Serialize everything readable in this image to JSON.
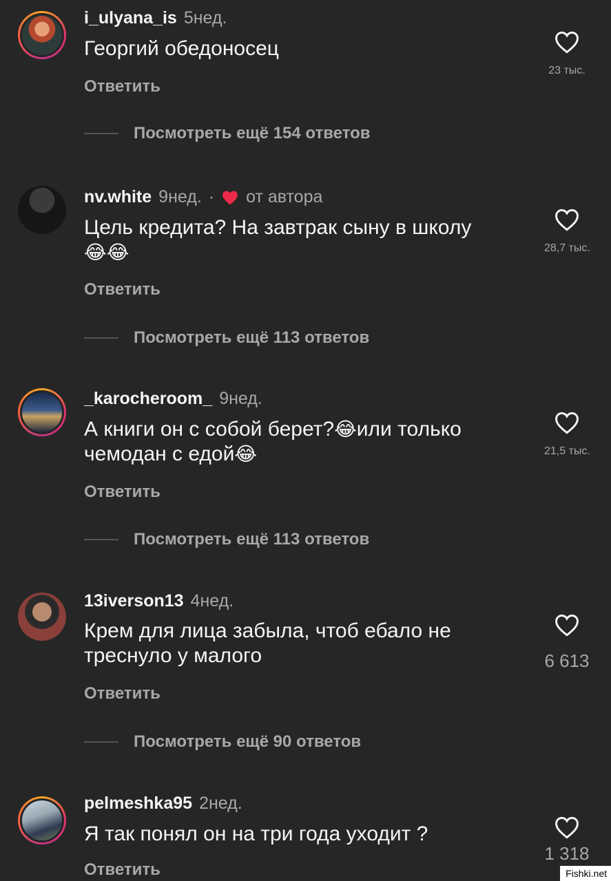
{
  "comments": [
    {
      "username": "i_ulyana_is",
      "time": "5нед.",
      "text": "Георгий обедоносец",
      "reply_label": "Ответить",
      "likes": "23 тыс.",
      "view_more": "Посмотреть ещё 154 ответов"
    },
    {
      "username": "nv.white",
      "time": "9нед.",
      "separator": "·",
      "author_badge": "от автора",
      "text": "Цель кредита? На завтрак сыну в школу",
      "text_emoji": "😂😂",
      "reply_label": "Ответить",
      "likes": "28,7 тыс.",
      "view_more": "Посмотреть ещё 113 ответов"
    },
    {
      "username": "_karocheroom_",
      "time": "9нед.",
      "text_part1": "А книги он с собой берет?",
      "emoji1": "😂",
      "text_part2": "или только чемодан с едой",
      "emoji2": "😂",
      "reply_label": "Ответить",
      "likes": "21,5 тыс.",
      "view_more": "Посмотреть ещё 113 ответов"
    },
    {
      "username": "13iverson13",
      "time": "4нед.",
      "text": "Крем для лица забыла, чтоб ебало не треснуло у малого",
      "reply_label": "Ответить",
      "likes": "6 613",
      "view_more": "Посмотреть ещё 90 ответов"
    },
    {
      "username": "pelmeshka95",
      "time": "2нед.",
      "text": "Я так понял он на три года уходит ?",
      "reply_label": "Ответить",
      "likes": "1 318"
    }
  ],
  "watermark": "Fishki.net",
  "colors": {
    "background": "#262626",
    "text_primary": "#f5f5f5",
    "text_secondary": "#a8a8a8",
    "author_heart": "#ed2a4a"
  },
  "icons": {
    "like": "heart-outline-icon",
    "author_like": "heart-filled-icon"
  }
}
